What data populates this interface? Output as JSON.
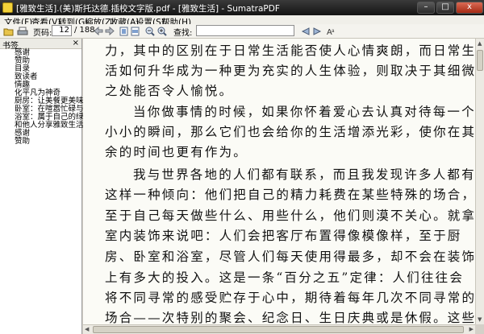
{
  "window": {
    "title": "[雅致生活].(美)斯托达德.插校文字版.pdf - [雅致生活] - SumatraPDF",
    "minimize": "–",
    "maximize": "□",
    "close": "x"
  },
  "menu": [
    "文件(F)",
    "查看(V)",
    "转到(G)",
    "缩放(Z)",
    "收藏(A)",
    "设置(S)",
    "帮助(H)"
  ],
  "toolbar": {
    "page_label": "页码:",
    "page_current": "12",
    "page_total": "/ 188",
    "find_label": "查找:",
    "find_value": "",
    "icons": [
      "open-icon",
      "print-icon",
      "back-icon",
      "forward-icon",
      "fit-page-icon",
      "fit-width-icon",
      "zoom-out-icon",
      "zoom-in-icon",
      "match-case-icon"
    ]
  },
  "sidebar": {
    "title": "书签",
    "close": "×",
    "bookmarks": [
      "感谢",
      "赞助",
      "目录",
      "致读者",
      "情趣",
      "化平凡为神奇",
      "厨房：让美餐更美味",
      "卧室：在喧嚣忙碌与寂",
      "浴室：属于自己的绿洲",
      "和他人分享雅致生活",
      "感谢",
      "赞助"
    ]
  },
  "document": {
    "lines": [
      "力，其中的区别在于日常生活能否使人心情爽朗，而日常生",
      "活如何升华成为一种更为充实的人生体验，则取决于其细微",
      "之处能否令人愉悦。",
      "当你做事情的时候，如果你怀着爱心去认真对待每一个",
      "小小的瞬间，那么它们也会给你的生活增添光彩，使你在其",
      "余的时间也更有作为。",
      "我与世界各地的人们都有联系，而且我发现许多人都有",
      "这样一种倾向：他们把自己的精力耗费在某些特殊的场合，",
      "至于自己每天做些什么、用些什么，他们则漠不关心。就拿",
      "室内装饰来说吧：人们会把客厅布置得像模像样，至于厨",
      "房、卧室和浴室，尽管人们每天使用得最多，却不会在装饰",
      "上有多大的投入。这是一条“百分之五”定律：人们往往会",
      "将不同寻常的感受贮存于心中，期待着每年几次不同寻常的",
      "场合——次特别的聚会、纪念日、生日庆典或是休假。这些"
    ]
  }
}
